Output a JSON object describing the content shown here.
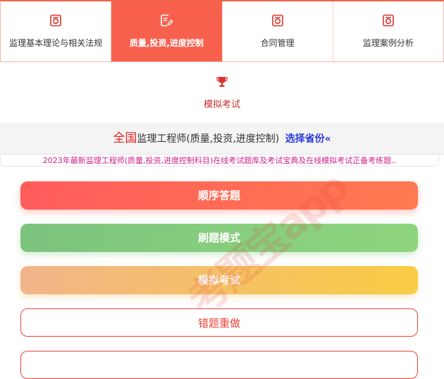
{
  "tabs": [
    {
      "label": "监理基本理论与相关法规",
      "icon": "exam-paper-icon",
      "active": false
    },
    {
      "label": "质量,投资,进度控制",
      "icon": "edit-document-icon",
      "active": true
    },
    {
      "label": "合同管理",
      "icon": "exam-paper-icon",
      "active": false
    },
    {
      "label": "监理案例分析",
      "icon": "exam-paper-icon",
      "active": false
    }
  ],
  "mock_tab": {
    "label": "模拟考试",
    "icon": "trophy-icon"
  },
  "region": {
    "scope": "全国",
    "title": "监理工程师(质量,投资,进度控制)",
    "select_label": "选择省份«"
  },
  "description": "2023年最新监理工程师(质量,投资,进度控制科目)在线考试题库及考试宝典及在线模拟考试正备考练题..",
  "buttons": {
    "sequential": "顺序答题",
    "practice": "刷题模式",
    "mock": "模拟考试",
    "wrong": "错题重做",
    "extra": ""
  },
  "watermark": "考题宝app",
  "colors": {
    "accent": "#f8604e",
    "green": "#7cc47e",
    "gold": "#f8cd44",
    "link": "#2c3ad9"
  }
}
